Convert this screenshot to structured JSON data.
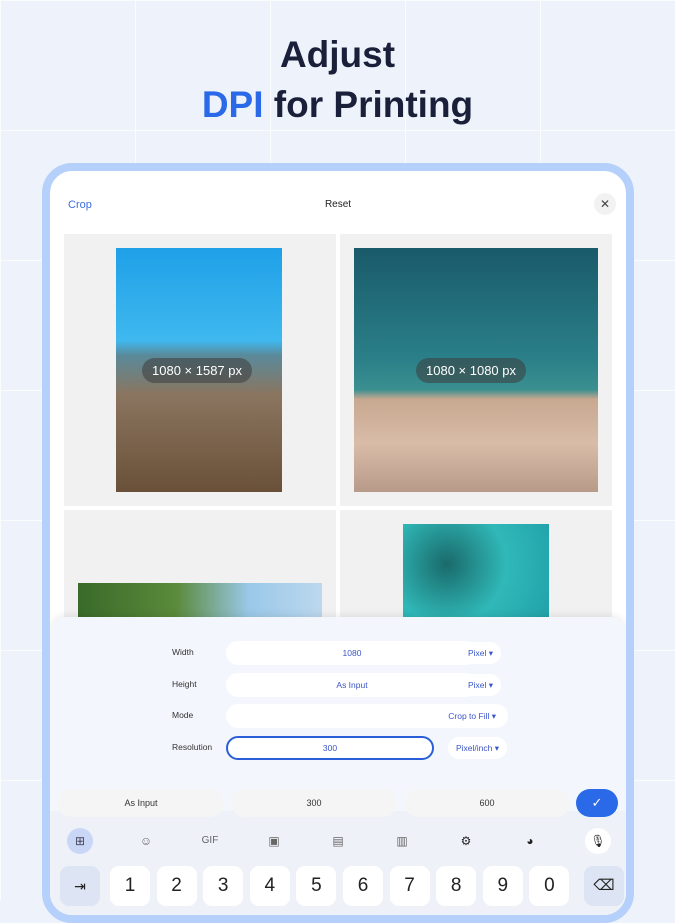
{
  "headline": {
    "line1": "Adjust",
    "accent": "DPI",
    "rest": " for Printing"
  },
  "topbar": {
    "crop": "Crop",
    "reset": "Reset",
    "close": "✕"
  },
  "photos": [
    {
      "dims": "1080 × 1587 px"
    },
    {
      "dims": "1080 × 1080 px"
    }
  ],
  "form": {
    "width": {
      "label": "Width",
      "value": "1080",
      "unit": "Pixel ▾"
    },
    "height": {
      "label": "Height",
      "value": "As Input",
      "unit": "Pixel ▾"
    },
    "mode": {
      "label": "Mode",
      "value": "Crop to Fill ▾"
    },
    "resolution": {
      "label": "Resolution",
      "value": "300",
      "unit": "Pixel/inch ▾"
    }
  },
  "suggestions": [
    "As Input",
    "300",
    "600"
  ],
  "confirm": "✓",
  "toolbar": {
    "gif": "GIF"
  },
  "keys": [
    "1",
    "2",
    "3",
    "4",
    "5",
    "6",
    "7",
    "8",
    "9",
    "0"
  ],
  "tab_key": "⇥",
  "backspace": "⌫",
  "colors": {
    "accent": "#2a6ae8",
    "frame": "#b5d0fb"
  }
}
